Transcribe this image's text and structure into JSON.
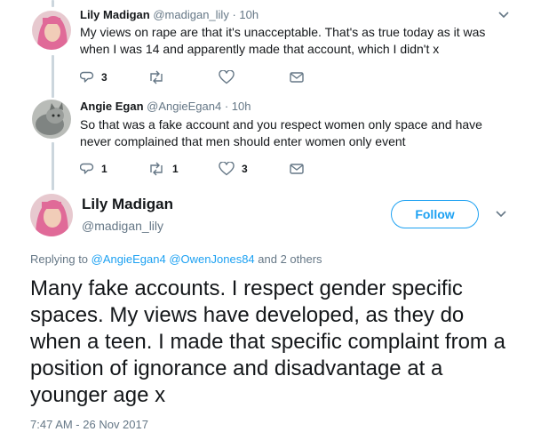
{
  "tweets": [
    {
      "name": "Lily Madigan",
      "handle": "@madigan_lily",
      "separator": "·",
      "time": "10h",
      "text": "My views on rape are that it's unacceptable. That's as true today as it was when I was 14 and apparently made that account, which I didn't x",
      "actions": {
        "reply_count": "3",
        "retweet_count": "",
        "like_count": ""
      }
    },
    {
      "name": "Angie Egan",
      "handle": "@AngieEgan4",
      "separator": "·",
      "time": "10h",
      "text": "So that was a fake account and you respect women only space and have never complained that men should enter women only event",
      "actions": {
        "reply_count": "1",
        "retweet_count": "1",
        "like_count": "3"
      }
    }
  ],
  "main_tweet": {
    "name": "Lily Madigan",
    "handle": "@madigan_lily",
    "follow_label": "Follow",
    "replying_prefix": "Replying to",
    "mention_1": "@AngieEgan4",
    "mention_2": "@OwenJones84",
    "replying_suffix": "and 2 others",
    "text": "Many fake accounts. I respect gender specific spaces. My views have developed, as they do when a teen. I made that specific complaint from a position of ignorance and disadvantage at a younger age x",
    "timestamp": "7:47 AM - 26 Nov 2017"
  },
  "colors": {
    "accent": "#1da1f2",
    "secondary_text": "#657786",
    "thread_line": "#ccd6dd"
  }
}
